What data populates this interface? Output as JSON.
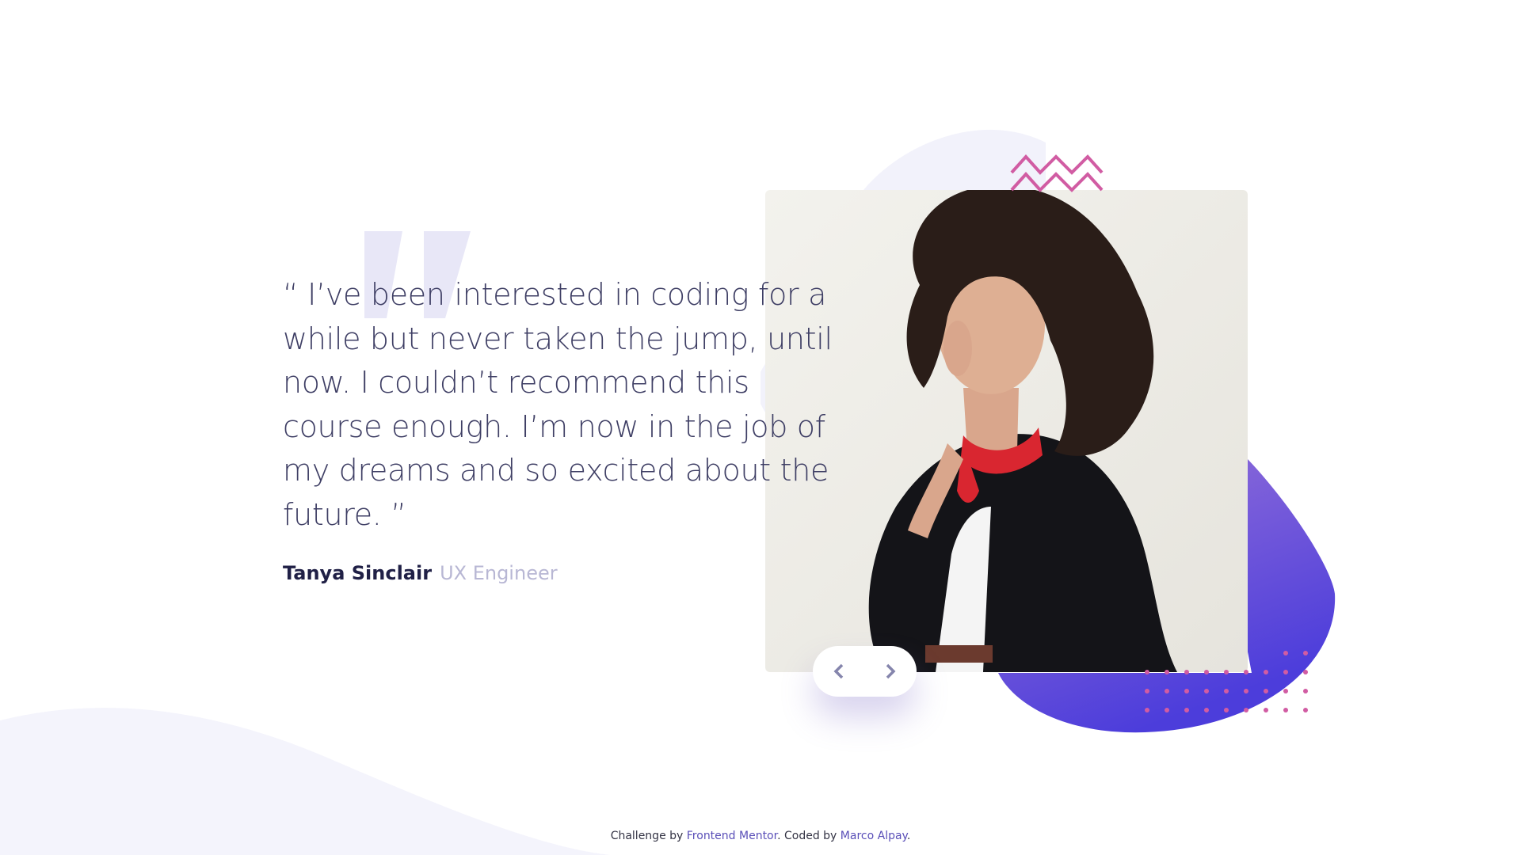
{
  "testimonial": {
    "quote": "“ I’ve been interested in coding for a while but never taken the jump, until now. I couldn’t recommend this course enough. I’m now in the job of my dreams and so excited about the future. ”",
    "author_name": "Tanya Sinclair",
    "author_role": "UX Engineer"
  },
  "navigation": {
    "prev_icon": "chevron-left-icon",
    "next_icon": "chevron-right-icon"
  },
  "footer": {
    "prefix": "Challenge by ",
    "challenge_link": "Frontend Mentor",
    "middle": ". Coded by ",
    "author_link": "Marco Alpay",
    "suffix": "."
  },
  "colors": {
    "text_dark": "#202046",
    "quote_text": "#3e3e64",
    "role_text": "#b8b7d4",
    "accent_purple": "#5a48dd",
    "accent_pink": "#d15ca3",
    "background_soft": "#f4f4fc"
  }
}
